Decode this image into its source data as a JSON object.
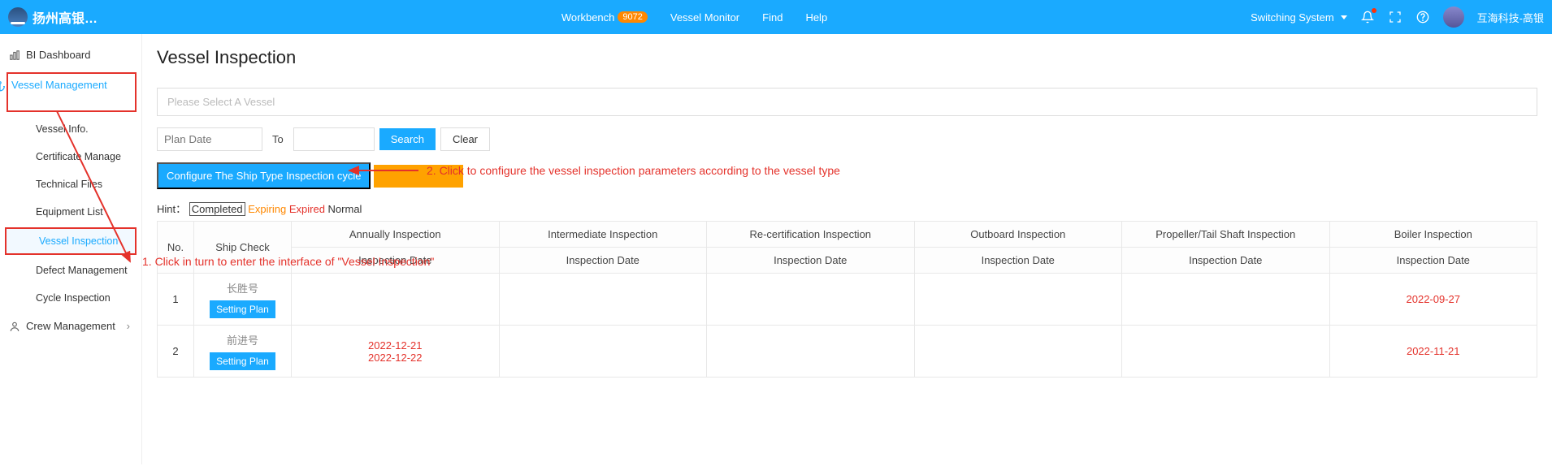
{
  "header": {
    "logo_text": "扬州高银…",
    "nav": {
      "workbench": "Workbench",
      "workbench_badge": "9072",
      "vessel_monitor": "Vessel Monitor",
      "find": "Find",
      "help": "Help"
    },
    "right": {
      "switching": "Switching System",
      "user_name": "互海科技-高银"
    }
  },
  "sidebar": {
    "bi_dashboard": "BI Dashboard",
    "vessel_management": "Vessel Management",
    "vessel_info": "Vessel Info.",
    "certificate_manage": "Certificate Manage",
    "technical_files": "Technical Files",
    "equipment_list": "Equipment List",
    "vessel_inspection": "Vessel Inspection",
    "defect_management": "Defect Management",
    "cycle_inspection": "Cycle Inspection",
    "crew_management": "Crew Management"
  },
  "main": {
    "title": "Vessel Inspection",
    "select_placeholder": "Please Select A Vessel",
    "plan_date_ph": "Plan Date",
    "to_label": "To",
    "search_btn": "Search",
    "clear_btn": "Clear",
    "configure_btn": "Configure The Ship Type Inspection cycle",
    "hint_label": "Hint：",
    "hint_completed": "Completed",
    "hint_expiring": "Expiring",
    "hint_expired": "Expired",
    "hint_normal": "Normal",
    "table": {
      "no": "No.",
      "ship_check": "Ship Check",
      "annually": "Annually Inspection",
      "intermediate": "Intermediate Inspection",
      "recert": "Re-certification Inspection",
      "outboard": "Outboard Inspection",
      "propeller": "Propeller/Tail Shaft Inspection",
      "boiler": "Boiler Inspection",
      "insp_date": "Inspection Date",
      "setting_plan": "Setting Plan"
    },
    "rows": [
      {
        "no": "1",
        "ship": "长胜号",
        "annually": "",
        "boiler": "2022-09-27"
      },
      {
        "no": "2",
        "ship": "前进号",
        "annually_a": "2022-12-21",
        "annually_b": "2022-12-22",
        "boiler": "2022-11-21"
      }
    ]
  },
  "annotations": {
    "anno1": "1. Click in turn to enter the interface of \"Vessel Inspection\"",
    "anno2": "2. Click to configure the vessel inspection parameters according to the vessel type"
  }
}
